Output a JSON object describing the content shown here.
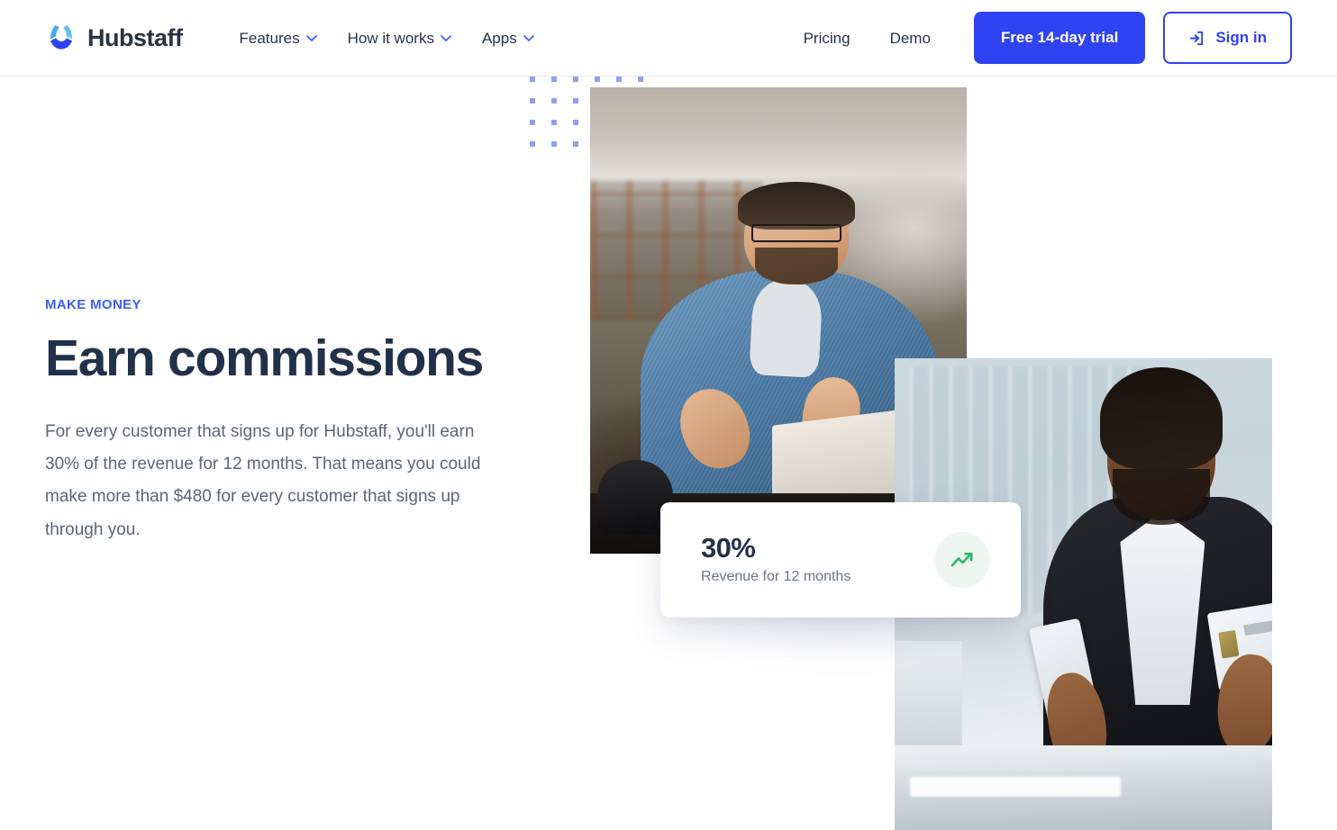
{
  "brand": {
    "name": "Hubstaff",
    "logo_icon": "hubstaff-logo-icon",
    "logo_color_light": "#4aa8f0",
    "logo_color_mid": "#3d8fe8",
    "logo_color_dark": "#2f43f2",
    "wordmark_color": "#273444"
  },
  "header": {
    "nav": [
      {
        "label": "Features",
        "has_dropdown": true,
        "icon": "chevron-down-icon"
      },
      {
        "label": "How it works",
        "has_dropdown": true,
        "icon": "chevron-down-icon"
      },
      {
        "label": "Apps",
        "has_dropdown": true,
        "icon": "chevron-down-icon"
      }
    ],
    "links": [
      {
        "label": "Pricing"
      },
      {
        "label": "Demo"
      }
    ],
    "trial_button": {
      "label": "Free 14-day trial",
      "background": "#2f43f2",
      "text_color": "#ffffff"
    },
    "signin_button": {
      "label": "Sign in",
      "icon": "sign-in-icon",
      "border_color": "#2f43f2",
      "text_color": "#2f43f2"
    }
  },
  "hero": {
    "eyebrow": "MAKE MONEY",
    "eyebrow_color": "#3b5bff",
    "title": "Earn commissions",
    "title_color": "#22314a",
    "body": "For every customer that signs up for Hubstaff, you'll earn 30% of the revenue for 12 months. That means you could make more than $480 for every customer that signs up through you.",
    "body_color": "#5b6676"
  },
  "decoration": {
    "dot_grid": {
      "icon": "dot-grid-decoration",
      "color": "#8da0f7",
      "columns": 6,
      "rows": 4,
      "spacing_px": 24,
      "dot_size_px": 6
    }
  },
  "media": {
    "primary_photo": {
      "icon": "photo-man-laughing-at-laptop",
      "alt": "Smiling man in denim shirt gesturing at a laptop"
    },
    "secondary_photo": {
      "icon": "photo-man-with-phone-and-card",
      "alt": "Man in suit holding a phone and a credit card"
    }
  },
  "stat_card": {
    "value": "30%",
    "value_color": "#22314a",
    "label": "Revenue for 12 months",
    "label_color": "#6b7684",
    "icon": "trending-up-icon",
    "icon_color": "#2bb862",
    "icon_background": "#edf6f0"
  }
}
